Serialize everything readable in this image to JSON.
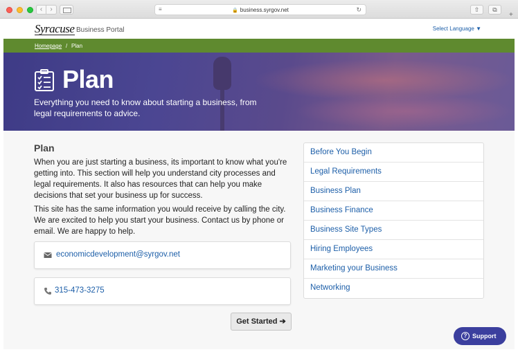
{
  "browser": {
    "url": "business.syrgov.net",
    "icons": [
      "back-icon",
      "forward-icon",
      "sidebar-icon",
      "lock-icon",
      "reload-icon",
      "share-icon",
      "tabs-icon",
      "new-tab-icon"
    ]
  },
  "header": {
    "logo_text": "Syracuse",
    "portal_label": "Business Portal",
    "language_label": "Select Language ▼"
  },
  "breadcrumb": {
    "home": "Homepage",
    "separator": "/",
    "current": "Plan"
  },
  "hero": {
    "title": "Plan",
    "subtitle": "Everything you need to know about starting a business, from legal requirements to advice.",
    "icon": "checklist-icon"
  },
  "main": {
    "heading": "Plan",
    "paragraph1": "When you are just starting a business, its important to know what you're getting into. This section will help you understand city processes and legal requirements. It also has resources that can help you make decisions that set your business up for success.",
    "paragraph2": "This site has the same information you would receive by calling the city. We are excited to help you start your business. Contact us by phone or email. We are happy to help.",
    "email": "economicdevelopment@syrgov.net",
    "phone": "315-473-3275",
    "get_started_label": "Get Started ➔"
  },
  "sidenav": {
    "items": [
      {
        "label": "Before You Begin"
      },
      {
        "label": "Legal Requirements"
      },
      {
        "label": "Business Plan"
      },
      {
        "label": "Business Finance"
      },
      {
        "label": "Business Site Types"
      },
      {
        "label": "Hiring Employees"
      },
      {
        "label": "Marketing your Business"
      },
      {
        "label": "Networking"
      }
    ]
  },
  "support": {
    "label": "Support"
  },
  "colors": {
    "green_bar": "#5f8a2f",
    "link": "#1c5ea8",
    "support": "#3b3f9e"
  }
}
